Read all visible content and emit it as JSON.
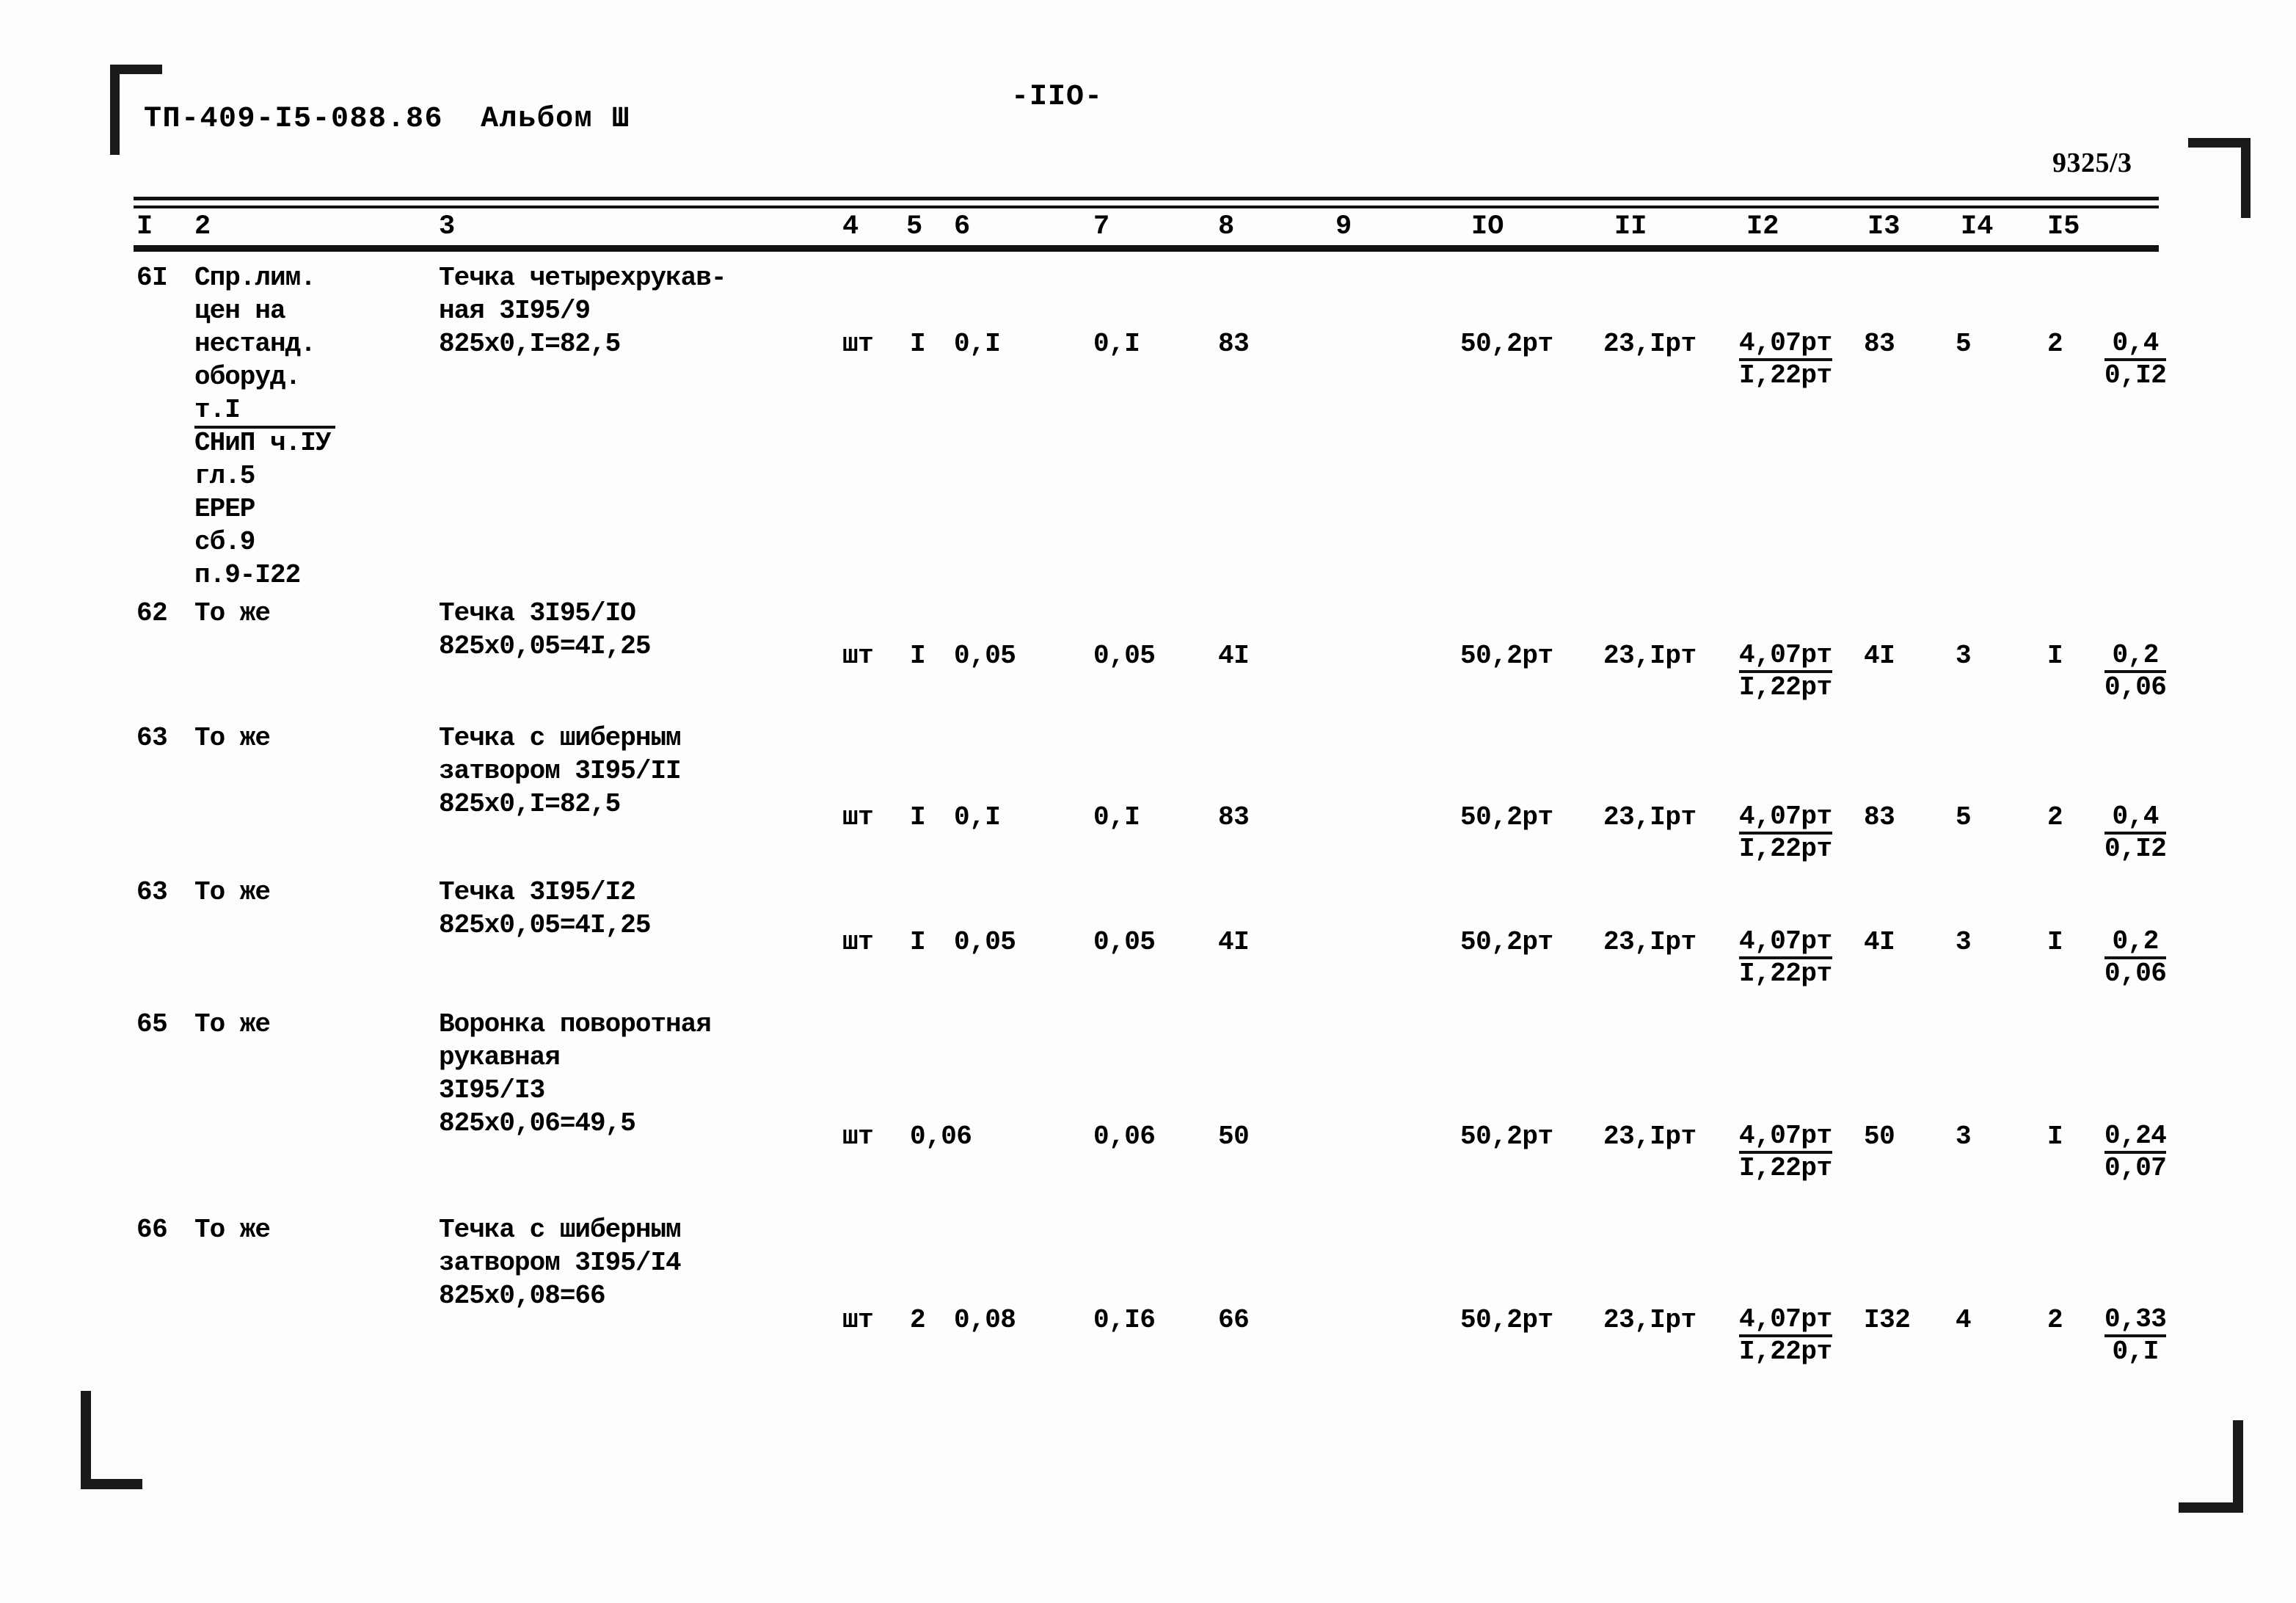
{
  "header": {
    "doc_code": "ТП-409-I5-088.86  Альбом Ш",
    "page_number": "-IIO-",
    "sheet_code": "9325/3"
  },
  "table": {
    "column_headers": [
      "I",
      "2",
      "3",
      "4",
      "5",
      "6",
      "7",
      "8",
      "9",
      "IO",
      "II",
      "I2",
      "I3",
      "I4",
      "I5"
    ],
    "rows": [
      {
        "c1": "6I",
        "c2_lines": [
          "Спр.лим.",
          "цен на",
          "нестанд.",
          "оборуд.",
          "т.I",
          "СНиП ч.IУ",
          "гл.5",
          "ЕРЕР",
          "сб.9",
          "п.9-I22"
        ],
        "c2_fraction_after_line": 5,
        "c3_lines": [
          "Течка четырехрукав-",
          "ная 3I95/9",
          "825х0,I=82,5"
        ],
        "c4": "шт",
        "c5": "I",
        "c6": "0,I",
        "c7": "0,I",
        "c8": "83",
        "c9": "",
        "c10": "50,2рт",
        "c11": "23,Iрт",
        "c12_num": "4,07рт",
        "c12_den": "I,22рт",
        "c13": "83",
        "c14": "5",
        "c15": "2",
        "c16_num": "0,4",
        "c16_den": "0,I2"
      },
      {
        "c1": "62",
        "c2_lines": [
          "То же"
        ],
        "c3_lines": [
          "Течка 3I95/IO",
          "825х0,05=4I,25"
        ],
        "c4": "шт",
        "c5": "I",
        "c6": "0,05",
        "c7": "0,05",
        "c8": "4I",
        "c9": "",
        "c10": "50,2рт",
        "c11": "23,Iрт",
        "c12_num": "4,07рт",
        "c12_den": "I,22рт",
        "c13": "4I",
        "c14": "3",
        "c15": "I",
        "c16_num": "0,2",
        "c16_den": "0,06"
      },
      {
        "c1": "63",
        "c2_lines": [
          "То же"
        ],
        "c3_lines": [
          "Течка с шиберным",
          "затвором 3I95/II",
          "825х0,I=82,5"
        ],
        "c4": "шт",
        "c5": "I",
        "c6": "0,I",
        "c7": "0,I",
        "c8": "83",
        "c9": "",
        "c10": "50,2рт",
        "c11": "23,Iрт",
        "c12_num": "4,07рт",
        "c12_den": "I,22рт",
        "c13": "83",
        "c14": "5",
        "c15": "2",
        "c16_num": "0,4",
        "c16_den": "0,I2"
      },
      {
        "c1": "63",
        "c2_lines": [
          "То же"
        ],
        "c3_lines": [
          "Течка 3I95/I2",
          "825х0,05=4I,25"
        ],
        "c4": "шт",
        "c5": "I",
        "c6": "0,05",
        "c7": "0,05",
        "c8": "4I",
        "c9": "",
        "c10": "50,2рт",
        "c11": "23,Iрт",
        "c12_num": "4,07рт",
        "c12_den": "I,22рт",
        "c13": "4I",
        "c14": "3",
        "c15": "I",
        "c16_num": "0,2",
        "c16_den": "0,06"
      },
      {
        "c1": "65",
        "c2_lines": [
          "То же"
        ],
        "c3_lines": [
          "Воронка поворотная",
          "рукавная",
          "3I95/I3",
          "825х0,06=49,5"
        ],
        "c4": "шт",
        "c5": "0,06",
        "c6": "",
        "c7": "0,06",
        "c8": "50",
        "c9": "",
        "c10": "50,2рт",
        "c11": "23,Iрт",
        "c12_num": "4,07рт",
        "c12_den": "I,22рт",
        "c13": "50",
        "c14": "3",
        "c15": "I",
        "c16_num": "0,24",
        "c16_den": "0,07"
      },
      {
        "c1": "66",
        "c2_lines": [
          "То же"
        ],
        "c3_lines": [
          "Течка с шиберным",
          "затвором 3I95/I4",
          "825х0,08=66"
        ],
        "c4": "шт",
        "c5": "2",
        "c6": "0,08",
        "c7": "0,I6",
        "c8": "66",
        "c9": "",
        "c10": "50,2рт",
        "c11": "23,Iрт",
        "c12_num": "4,07рт",
        "c12_den": "I,22рт",
        "c13": "I32",
        "c14": "4",
        "c15": "2",
        "c16_num": "0,33",
        "c16_den": "0,I"
      }
    ]
  }
}
